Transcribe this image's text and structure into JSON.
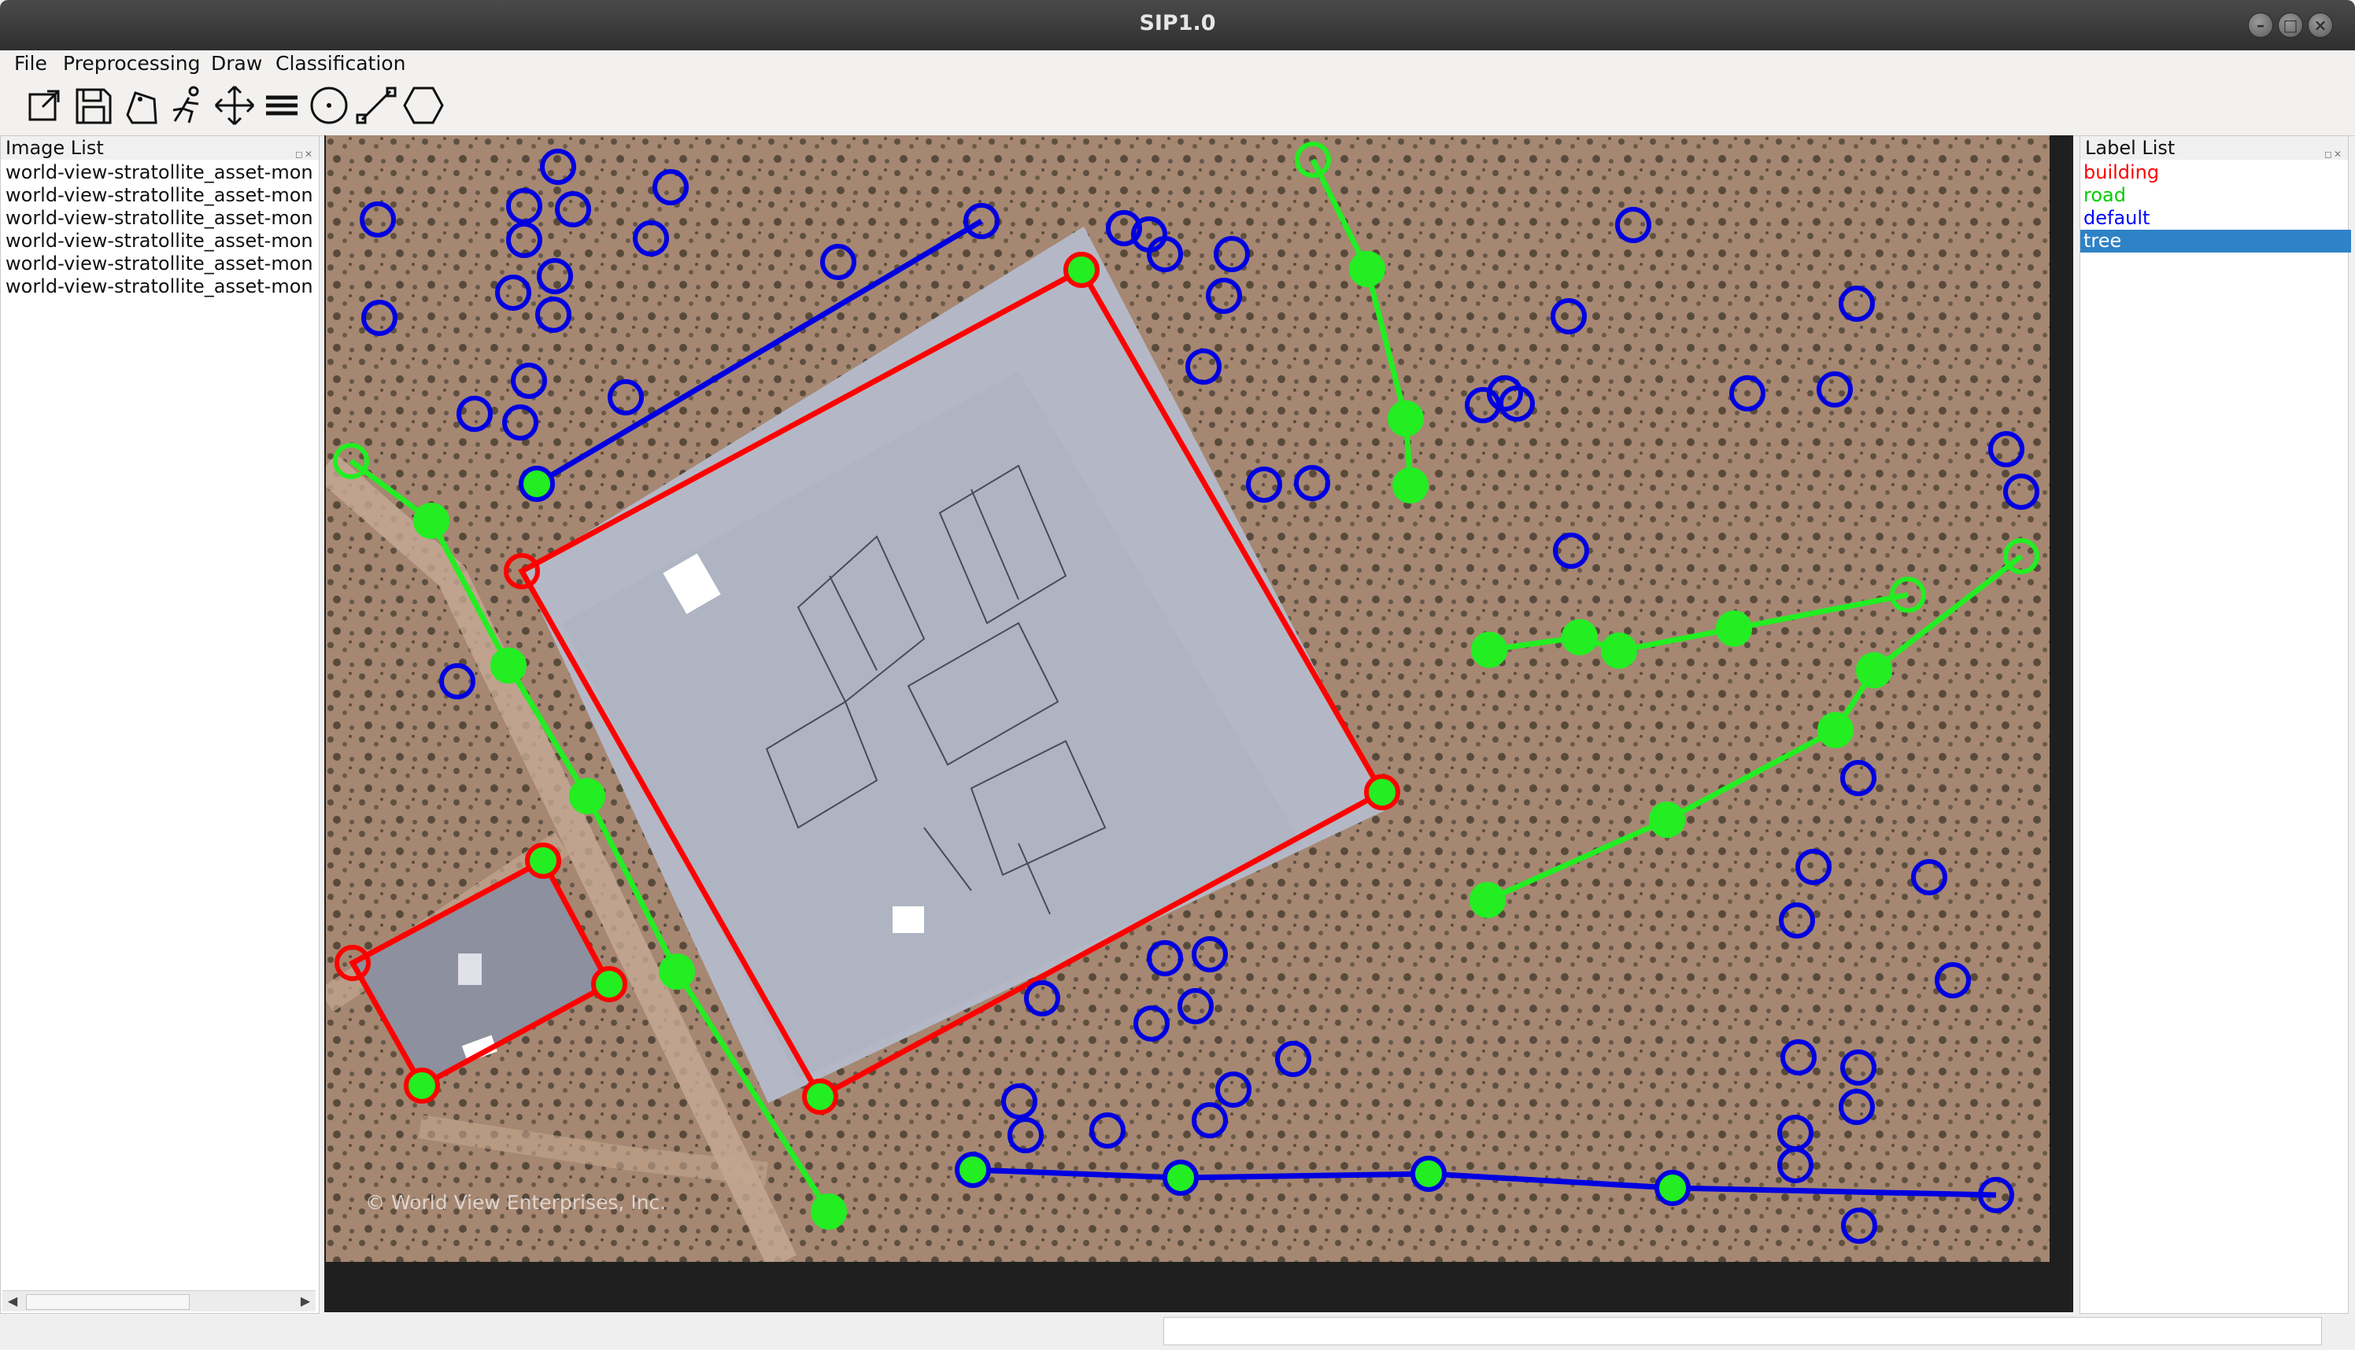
{
  "window": {
    "title": "SIP1.0"
  },
  "menu": {
    "file": "File",
    "preprocessing": "Preprocessing",
    "draw": "Draw",
    "classification": "Classification"
  },
  "toolbar": {
    "tools": [
      "open-icon",
      "save-icon",
      "tag-icon",
      "walk-icon",
      "move-icon",
      "menu-icon",
      "circle-tool-icon",
      "line-tool-icon",
      "polygon-tool-icon"
    ]
  },
  "image_list": {
    "title": "Image List",
    "items": [
      "world-view-stratollite_asset-mon",
      "world-view-stratollite_asset-mon",
      "world-view-stratollite_asset-mon",
      "world-view-stratollite_asset-mon",
      "world-view-stratollite_asset-mon",
      "world-view-stratollite_asset-mon"
    ]
  },
  "label_list": {
    "title": "Label List",
    "items": [
      {
        "label": "building",
        "color": "#ff0000"
      },
      {
        "label": "road",
        "color": "#00cc00"
      },
      {
        "label": "default",
        "color": "#0000ff"
      },
      {
        "label": "tree",
        "color": "#ffffff",
        "selected": true
      }
    ]
  },
  "canvas": {
    "watermark": "© World View Enterprises, Inc.",
    "colors": {
      "building": "#ff0000",
      "road": "#22ee22",
      "default": "#0000e0"
    }
  }
}
